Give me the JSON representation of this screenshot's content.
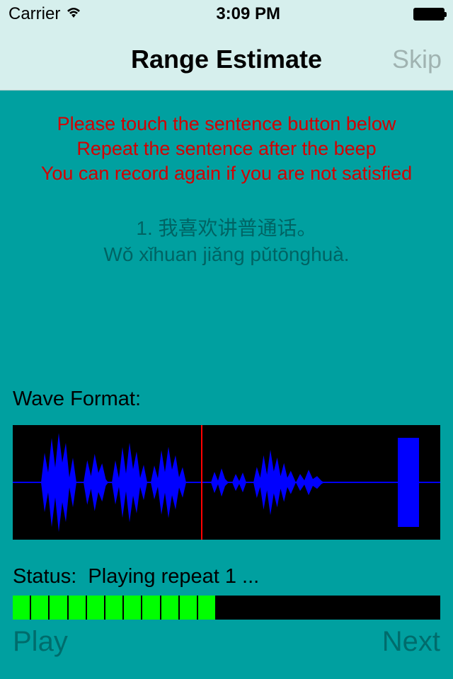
{
  "statusbar": {
    "carrier": "Carrier",
    "time": "3:09 PM"
  },
  "navbar": {
    "title": "Range Estimate",
    "skip": "Skip"
  },
  "instructions": {
    "line1": "Please touch the sentence button below",
    "line2": "Repeat the sentence after the beep",
    "line3": "You can record again if you are not satisfied"
  },
  "sentence": {
    "line1": "1. 我喜欢讲普通话。",
    "line2": "Wǒ xǐhuan jiǎng pǔtōnghuà."
  },
  "wave": {
    "label": "Wave Format:",
    "cursor_pct": 44
  },
  "status": {
    "label": "Status:",
    "value": "Playing repeat 1 ..."
  },
  "progress": {
    "filled": 11
  },
  "buttons": {
    "play": "Play",
    "next": "Next"
  }
}
